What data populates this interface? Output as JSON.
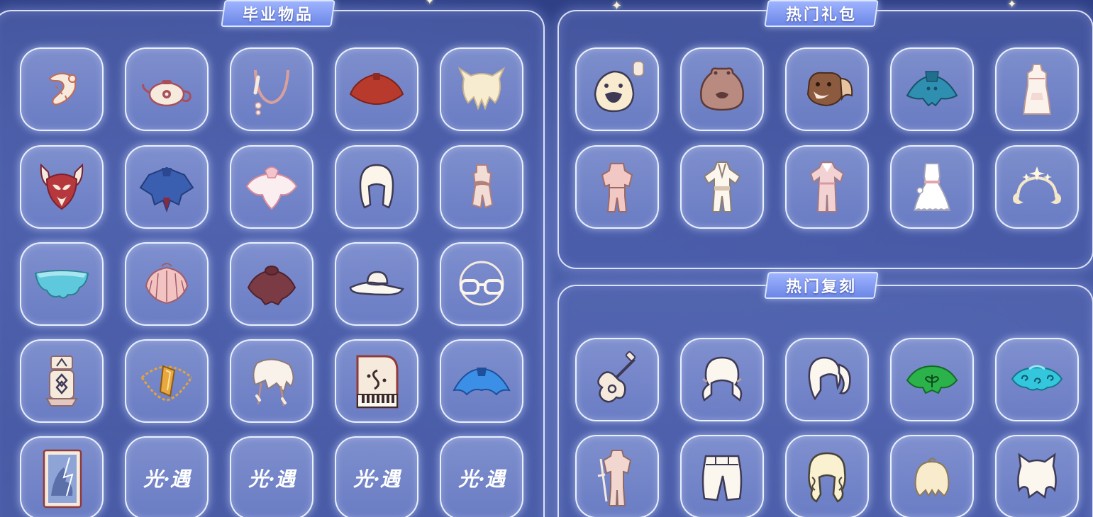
{
  "panels": {
    "graduation": {
      "title": "毕业物品",
      "items": [
        {
          "icon": "ferret-accessory-icon"
        },
        {
          "icon": "teapot-icon"
        },
        {
          "icon": "necklace-icon"
        },
        {
          "icon": "red-cape-icon"
        },
        {
          "icon": "blonde-horned-hair-icon"
        },
        {
          "icon": "horned-owl-mask-icon"
        },
        {
          "icon": "blue-cape-icon"
        },
        {
          "icon": "pink-flower-cape-icon"
        },
        {
          "icon": "long-hair-icon"
        },
        {
          "icon": "pink-outfit-icon"
        },
        {
          "icon": "cyan-cloud-cape-icon"
        },
        {
          "icon": "pink-shell-cape-icon"
        },
        {
          "icon": "maroon-cape-icon"
        },
        {
          "icon": "white-hat-icon"
        },
        {
          "icon": "glasses-icon"
        },
        {
          "icon": "altar-prop-icon"
        },
        {
          "icon": "golden-crystal-pendant-icon"
        },
        {
          "icon": "feathered-hair-icon"
        },
        {
          "icon": "piano-icon"
        },
        {
          "icon": "blue-wing-cape-icon"
        },
        {
          "icon": "card-art-icon"
        },
        {
          "icon": "game-logo-icon",
          "label": "光·遇"
        },
        {
          "icon": "game-logo-icon",
          "label": "光·遇"
        },
        {
          "icon": "game-logo-icon",
          "label": "光·遇"
        },
        {
          "icon": "game-logo-icon",
          "label": "光·遇"
        }
      ]
    },
    "gift": {
      "title": "热门礼包",
      "items": [
        {
          "icon": "duck-hat-icon"
        },
        {
          "icon": "frog-hat-icon"
        },
        {
          "icon": "squirrel-hat-icon"
        },
        {
          "icon": "teal-cape-icon"
        },
        {
          "icon": "white-dress-icon"
        },
        {
          "icon": "pink-outfit-icon"
        },
        {
          "icon": "white-robe-icon"
        },
        {
          "icon": "pink-robe-icon"
        },
        {
          "icon": "white-lace-dress-icon"
        },
        {
          "icon": "moon-star-headband-icon"
        }
      ]
    },
    "rerun": {
      "title": "热门复刻",
      "items": [
        {
          "icon": "guitar-icon"
        },
        {
          "icon": "twin-tails-hair-icon"
        },
        {
          "icon": "ponytail-hair-icon"
        },
        {
          "icon": "green-leaf-cape-icon"
        },
        {
          "icon": "cyan-swirl-cape-icon"
        },
        {
          "icon": "swordsman-outfit-icon"
        },
        {
          "icon": "white-pants-icon"
        },
        {
          "icon": "curly-hair-icon"
        },
        {
          "icon": "short-blonde-hair-icon"
        },
        {
          "icon": "cat-ear-hair-icon"
        }
      ]
    }
  },
  "colors": {
    "background": "#3a4c95",
    "slot_fill": "#7f92cf",
    "slot_border": "#eef2ff",
    "tab_fill": "#7f98ee",
    "cream": "#f6eadd",
    "red": "#b83a2c",
    "maroon": "#7a3b45",
    "blue": "#3b5fb0",
    "bright_blue": "#3b8fe6",
    "cyan": "#34c6dc",
    "green": "#2bb24a",
    "pink": "#f2c8c4",
    "gold": "#e2a43a"
  }
}
